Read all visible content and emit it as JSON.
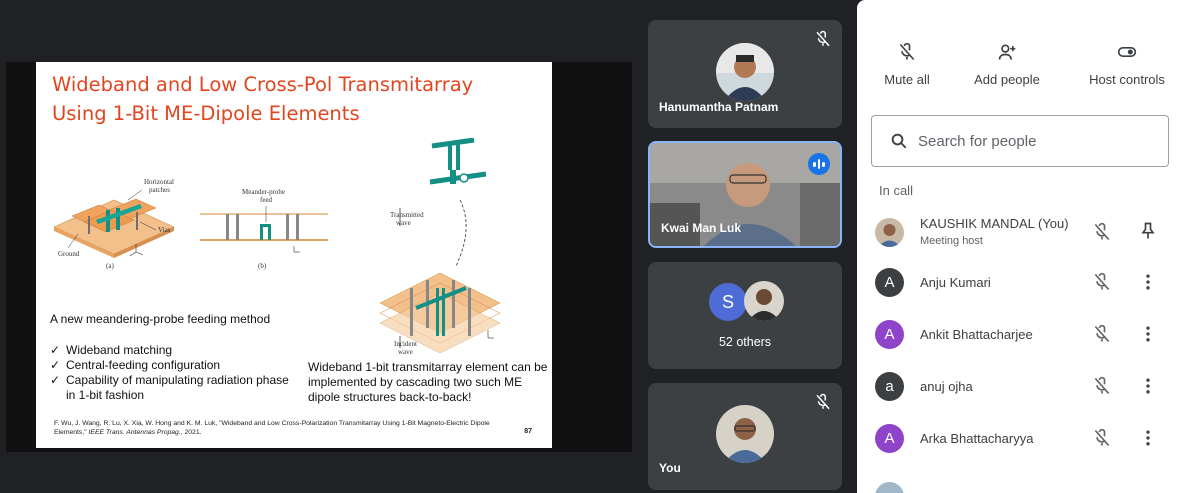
{
  "slide": {
    "title_line1": "Wideband and Low Cross-Pol Transmitarray",
    "title_line2": "Using 1-Bit ME-Dipole Elements",
    "fig_labels": {
      "horizontal": "Horizontal",
      "patches": "patches",
      "vias": "Vias",
      "ground": "Ground",
      "a": "(a)",
      "meander": "Meander-probe",
      "feed": "feed",
      "b": "(b)",
      "transmitted": "Transmitted",
      "wave": "wave",
      "incident": "Incident",
      "incident_wave": "wave"
    },
    "feed_line": "A new meandering-probe feeding method",
    "bullets": [
      "Wideband matching",
      "Central-feeding configuration",
      "Capability of manipulating radiation phase in 1-bit fashion"
    ],
    "wideband_text": "Wideband 1-bit transmitarray element can be implemented by cascading two such ME dipole structures back-to-back!",
    "reference_plain": "F. Wu, J. Wang, R. Lu, X. Xia, W. Hong and K. M. Luk, \"Wideband and Low Cross-Polarization Transmitarray Using 1-Bit Magneto-Electric Dipole Elements,\" ",
    "reference_italic": "IEEE Trans. Antennas Propag.",
    "reference_end": ", 2021.",
    "page_number": "87"
  },
  "tiles": {
    "hanumantha": "Hanumantha Patnam",
    "kwai": "Kwai Man Luk",
    "others_initial": "S",
    "others": "52 others",
    "you": "You"
  },
  "panel": {
    "controls": {
      "mute_all": "Mute all",
      "add_people": "Add people",
      "host_controls": "Host controls"
    },
    "search_placeholder": "Search for people",
    "in_call": "In call",
    "people": [
      {
        "name": "KAUSHIK MANDAL (You)",
        "sub": "Meeting host",
        "color": "#8d6e63"
      },
      {
        "name": "Anju Kumari",
        "initial": "A",
        "color": "#3c4043"
      },
      {
        "name": "Ankit Bhattacharjee",
        "initial": "A",
        "color": "#8e44c9"
      },
      {
        "name": "anuj ojha",
        "initial": "a",
        "color": "#3c4043"
      },
      {
        "name": "Arka Bhattacharyya",
        "initial": "A",
        "color": "#8e44c9"
      }
    ]
  },
  "colors": {
    "accent_blue": "#1a73e8",
    "title_red": "#e3451f",
    "tile_bg": "#3c4043"
  }
}
